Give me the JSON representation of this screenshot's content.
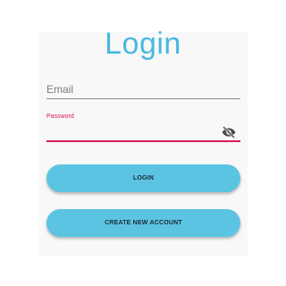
{
  "title": "Login",
  "email": {
    "placeholder": "Email",
    "value": ""
  },
  "password": {
    "label": "Password",
    "value": "",
    "toggle_icon": "visibility-off-icon"
  },
  "buttons": {
    "login": "LOGIN",
    "create_account": "CREATE NEW ACCOUNT"
  },
  "colors": {
    "accent": "#4ab8df",
    "button": "#5bc4e2",
    "focus": "#d81b60"
  }
}
